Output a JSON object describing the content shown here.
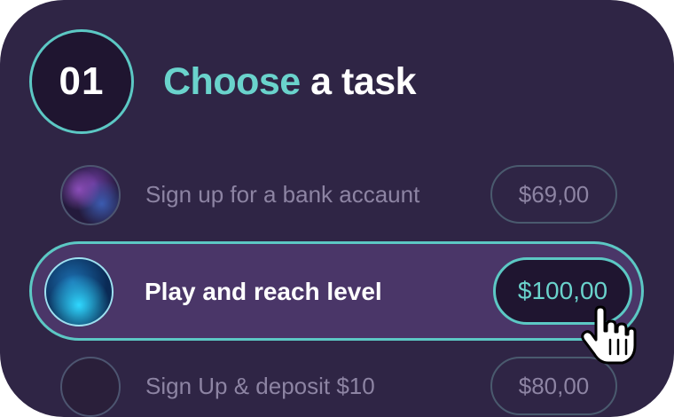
{
  "step": {
    "number": "01"
  },
  "title": {
    "accent": "Choose",
    "rest": " a task"
  },
  "tasks": [
    {
      "label": "Sign up for a bank accaunt",
      "price": "$69,00",
      "state": "inactive"
    },
    {
      "label": "Play and reach level",
      "price": "$100,00",
      "state": "active"
    },
    {
      "label": "Sign Up & deposit $10",
      "price": "$80,00",
      "state": "inactive"
    }
  ],
  "colors": {
    "background": "#2f2545",
    "accent": "#6ad3cc",
    "active_row": "#4a3668"
  },
  "icons": {
    "cursor": "hand-pointer-icon"
  }
}
